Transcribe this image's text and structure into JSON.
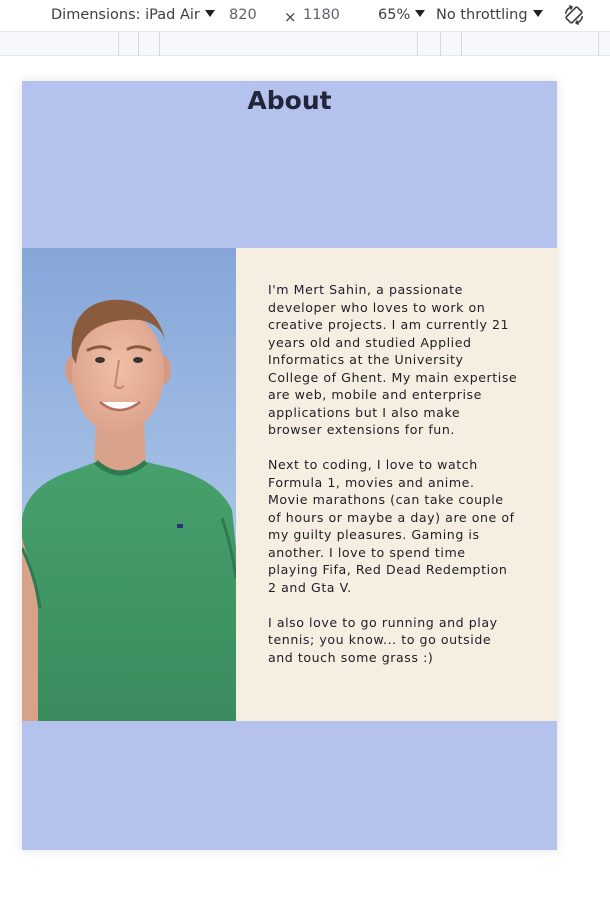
{
  "devtools": {
    "dimensions_label": "Dimensions: iPad Air",
    "width_value": "820",
    "times_symbol": "×",
    "height_value": "1180",
    "zoom_label": "65%",
    "throttling_label": "No throttling"
  },
  "page": {
    "title": "About",
    "paragraphs": [
      "I'm Mert Sahin, a passionate developer who loves to work on creative projects. I am currently 21 years old and studied Applied Informatics at the University College of Ghent. My main expertise are web, mobile and enterprise applications but I also make browser extensions for fun.",
      "Next to coding, I love to watch Formula 1, movies and anime. Movie marathons (can take couple of hours or maybe a day) are one of my guilty pleasures. Gaming is another. I love to spend time playing Fifa, Red Dead Redemption 2 and Gta V.",
      "I also love to go running and play tennis; you know... to go outside and touch some grass :)"
    ]
  },
  "colors": {
    "section_background": "#b6c2ee",
    "text_panel_background": "#f6eee0",
    "title_color": "#22263b",
    "shirt_green": "#3f9a66",
    "sky_blue": "#8eaedc"
  },
  "icons": {
    "rotate": "rotate-device-icon",
    "dropdown": "caret-down-icon"
  }
}
